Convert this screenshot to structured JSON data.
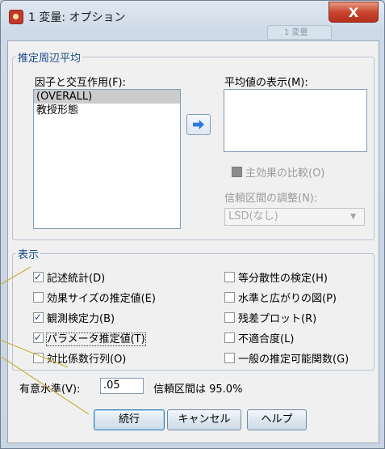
{
  "window": {
    "title": "1 変量: オプション",
    "close_glyph": "X",
    "ghost_tab": "1 変量"
  },
  "emm_group": {
    "legend": "推定周辺平均",
    "factors_label": "因子と交互作用(F):",
    "factors": [
      "(OVERALL)",
      "教授形態"
    ],
    "selected_factor": "(OVERALL)",
    "means_label": "平均値の表示(M):",
    "compare_main_effects": {
      "label": "主効果の比較(O)",
      "checked": false,
      "enabled": false
    },
    "ci_adjust_label": "信頼区間の調整(N):",
    "ci_adjust_value": "LSD(なし)"
  },
  "display_group": {
    "legend": "表示",
    "options": [
      {
        "label": "記述統計(D)",
        "checked": true
      },
      {
        "label": "効果サイズの推定値(E)",
        "checked": false
      },
      {
        "label": "観測検定力(B)",
        "checked": true
      },
      {
        "label": "パラメータ推定値(T)",
        "checked": true
      },
      {
        "label": "対比係数行列(O)",
        "checked": false
      },
      {
        "label": "等分散性の検定(H)",
        "checked": false
      },
      {
        "label": "水準と広がりの図(P)",
        "checked": false
      },
      {
        "label": "残差プロット(R)",
        "checked": false
      },
      {
        "label": "不適合度(L)",
        "checked": false
      },
      {
        "label": "一般の推定可能関数(G)",
        "checked": false
      }
    ]
  },
  "significance": {
    "label": "有意水準(V):",
    "value": ".05",
    "ci_text": "信頼区間は 95.0%"
  },
  "buttons": {
    "continue": "続行",
    "cancel": "キャンセル",
    "help": "ヘルプ"
  },
  "colors": {
    "legend_text": "#1a4a8a",
    "callout_line": "#c8b040",
    "close_button": "#c9452e"
  }
}
